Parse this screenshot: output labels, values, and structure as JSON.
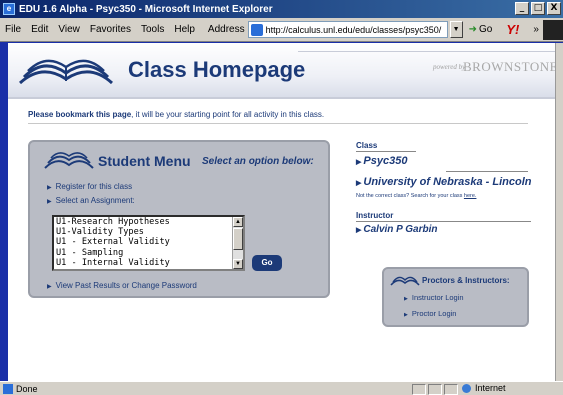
{
  "window": {
    "title": "EDU 1.6 Alpha - Psyc350 - Microsoft Internet Explorer",
    "controls": [
      "_",
      "□",
      "X"
    ]
  },
  "menu": [
    "File",
    "Edit",
    "View",
    "Favorites",
    "Tools",
    "Help"
  ],
  "address": {
    "label": "Address",
    "url": "http://calculus.unl.edu/edu/classes/psyc350/",
    "go": "Go"
  },
  "toolbar": {
    "more": "»"
  },
  "page": {
    "title": "Class Homepage",
    "powered_by": "powered by",
    "brand": "BROWNSTONE",
    "bookmark_bold": "Please bookmark this page",
    "bookmark_rest": ", it will be your starting point for all activity in this class."
  },
  "student_menu": {
    "title": "Student Menu",
    "subtitle": "Select an option below:",
    "register": "Register for this class",
    "select_assignment": "Select an Assignment:",
    "assignments": [
      "U1-Research Hypotheses",
      "U1-Validity Types",
      "U1 - External Validity",
      "U1 - Sampling",
      "U1 - Internal Validity"
    ],
    "go": "Go",
    "past_results": "View Past Results or Change Password"
  },
  "class_info": {
    "class_label": "Class",
    "class_name": "Psyc350",
    "university": "University of Nebraska - Lincoln",
    "note_text": "Not the correct class? Search for your class",
    "note_link": "here.",
    "instructor_label": "Instructor",
    "instructor_name": "Calvin P Garbin"
  },
  "proctors": {
    "title": "Proctors & Instructors:",
    "instructor_login": "Instructor Login",
    "proctor_login": "Proctor Login"
  },
  "status": {
    "text": "Done",
    "zone": "Internet"
  }
}
